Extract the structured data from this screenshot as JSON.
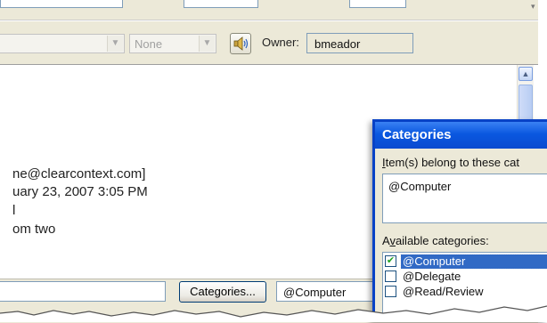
{
  "toolbar": {
    "combo_empty_value": "",
    "combo_none_value": "None",
    "owner_label": "Owner:",
    "owner_value": "bmeador"
  },
  "message": {
    "lines": [
      "ne@clearcontext.com]",
      "uary 23, 2007 3:05 PM",
      "l",
      "om two"
    ]
  },
  "bottom_bar": {
    "categories_button": {
      "pre": "Cate",
      "accel": "g",
      "post": "ories..."
    },
    "categories_value": "@Computer"
  },
  "dialog": {
    "title": "Categories",
    "prompt": {
      "accel": "I",
      "rest": "tem(s) belong to these cat"
    },
    "items_value": "@Computer",
    "available": {
      "pre": "A",
      "accel": "v",
      "post": "ailable categories:"
    },
    "categories": [
      {
        "label": "@Computer",
        "checked": true,
        "selected": true
      },
      {
        "label": "@Delegate",
        "checked": false,
        "selected": false
      },
      {
        "label": "@Read/Review",
        "checked": false,
        "selected": false
      }
    ]
  },
  "colors": {
    "titlebar": "#0a58e0",
    "selection": "#316ac5",
    "window_bg": "#ece9d8"
  }
}
